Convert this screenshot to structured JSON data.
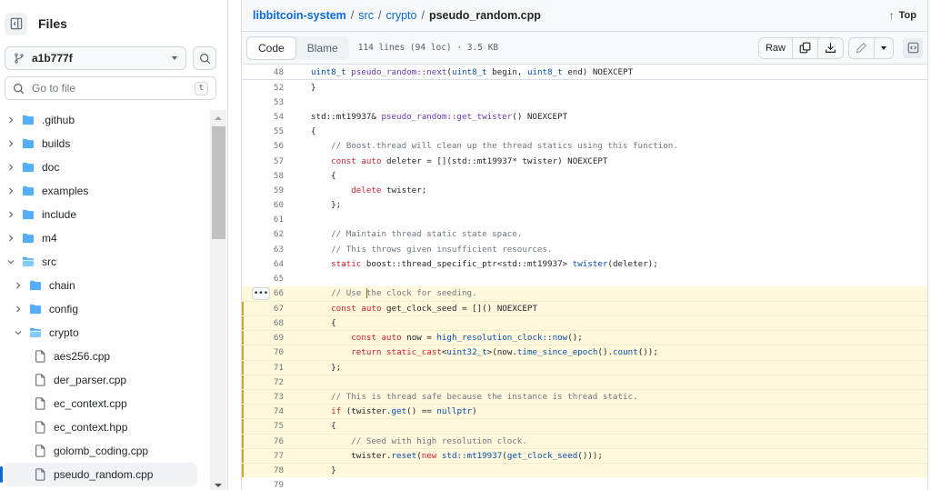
{
  "sidebar": {
    "title": "Files",
    "toggle_icon": "sidebar-collapse-icon",
    "branch": "a1b777f",
    "goto_placeholder": "Go to file",
    "goto_shortcut": "t",
    "tree": [
      {
        "label": ".github",
        "type": "folder",
        "depth": 0,
        "expanded": false
      },
      {
        "label": "builds",
        "type": "folder",
        "depth": 0,
        "expanded": false
      },
      {
        "label": "doc",
        "type": "folder",
        "depth": 0,
        "expanded": false
      },
      {
        "label": "examples",
        "type": "folder",
        "depth": 0,
        "expanded": false
      },
      {
        "label": "include",
        "type": "folder",
        "depth": 0,
        "expanded": false
      },
      {
        "label": "m4",
        "type": "folder",
        "depth": 0,
        "expanded": false
      },
      {
        "label": "src",
        "type": "folder",
        "depth": 0,
        "expanded": true
      },
      {
        "label": "chain",
        "type": "folder",
        "depth": 1,
        "expanded": false
      },
      {
        "label": "config",
        "type": "folder",
        "depth": 1,
        "expanded": false
      },
      {
        "label": "crypto",
        "type": "folder",
        "depth": 1,
        "expanded": true
      },
      {
        "label": "aes256.cpp",
        "type": "file",
        "depth": 2
      },
      {
        "label": "der_parser.cpp",
        "type": "file",
        "depth": 2
      },
      {
        "label": "ec_context.cpp",
        "type": "file",
        "depth": 2
      },
      {
        "label": "ec_context.hpp",
        "type": "file",
        "depth": 2
      },
      {
        "label": "golomb_coding.cpp",
        "type": "file",
        "depth": 2
      },
      {
        "label": "pseudo_random.cpp",
        "type": "file",
        "depth": 2,
        "selected": true
      }
    ]
  },
  "header": {
    "breadcrumb": {
      "repo": "libbitcoin-system",
      "parts": [
        "src",
        "crypto"
      ],
      "file": "pseudo_random.cpp",
      "separator": "/"
    },
    "top_label": "Top"
  },
  "toolbar": {
    "code_tab": "Code",
    "blame_tab": "Blame",
    "file_info": "114 lines (94 loc) · 3.5 KB",
    "raw_label": "Raw"
  },
  "code": {
    "sticky": {
      "n": "48",
      "tokens": [
        [
          "ty",
          "uint8_t"
        ],
        [
          "pl",
          " "
        ],
        [
          "fn",
          "pseudo_random::next"
        ],
        [
          "pl",
          "("
        ],
        [
          "ty",
          "uint8_t"
        ],
        [
          "pl",
          " begin, "
        ],
        [
          "ty",
          "uint8_t"
        ],
        [
          "pl",
          " end) NOEXCEPT"
        ]
      ]
    },
    "lines": [
      {
        "n": "52",
        "tokens": [
          [
            "pl",
            "}"
          ]
        ]
      },
      {
        "n": "53",
        "tokens": []
      },
      {
        "n": "54",
        "tokens": [
          [
            "pl",
            "std::mt19937& "
          ],
          [
            "fn",
            "pseudo_random::get_twister"
          ],
          [
            "pl",
            "() NOEXCEPT"
          ]
        ]
      },
      {
        "n": "55",
        "tokens": [
          [
            "pl",
            "{"
          ]
        ]
      },
      {
        "n": "56",
        "tokens": [
          [
            "pl",
            "    "
          ],
          [
            "cm",
            "// Boost.thread will clean up the thread statics using this function."
          ]
        ]
      },
      {
        "n": "57",
        "tokens": [
          [
            "pl",
            "    "
          ],
          [
            "kw",
            "const"
          ],
          [
            "pl",
            " "
          ],
          [
            "kw",
            "auto"
          ],
          [
            "pl",
            " deleter = [](std::mt19937* twister) NOEXCEPT"
          ]
        ]
      },
      {
        "n": "58",
        "tokens": [
          [
            "pl",
            "    {"
          ]
        ]
      },
      {
        "n": "59",
        "tokens": [
          [
            "pl",
            "        "
          ],
          [
            "kw",
            "delete"
          ],
          [
            "pl",
            " twister;"
          ]
        ]
      },
      {
        "n": "60",
        "tokens": [
          [
            "pl",
            "    };"
          ]
        ]
      },
      {
        "n": "61",
        "tokens": []
      },
      {
        "n": "62",
        "tokens": [
          [
            "pl",
            "    "
          ],
          [
            "cm",
            "// Maintain thread static state space."
          ]
        ]
      },
      {
        "n": "63",
        "tokens": [
          [
            "pl",
            "    "
          ],
          [
            "cm",
            "// This throws given insufficient resources."
          ]
        ]
      },
      {
        "n": "64",
        "tokens": [
          [
            "pl",
            "    "
          ],
          [
            "kw",
            "static"
          ],
          [
            "pl",
            " boost::thread_specific_ptr<std::mt19937> "
          ],
          [
            "ty",
            "twister"
          ],
          [
            "pl",
            "(deleter);"
          ]
        ]
      },
      {
        "n": "65",
        "tokens": []
      },
      {
        "n": "66",
        "hl": true,
        "dots": true,
        "tokens": [
          [
            "pl",
            "    "
          ],
          [
            "cm",
            "// Use "
          ],
          [
            "cursor",
            ""
          ],
          [
            "cm",
            "the clock for seeding."
          ]
        ]
      },
      {
        "n": "67",
        "hl": true,
        "bar": true,
        "tokens": [
          [
            "pl",
            "    "
          ],
          [
            "kw",
            "const"
          ],
          [
            "pl",
            " "
          ],
          [
            "kw",
            "auto"
          ],
          [
            "pl",
            " get_clock_seed = []() NOEXCEPT"
          ]
        ]
      },
      {
        "n": "68",
        "hl": true,
        "bar": true,
        "tokens": [
          [
            "pl",
            "    {"
          ]
        ]
      },
      {
        "n": "69",
        "hl": true,
        "bar": true,
        "tokens": [
          [
            "pl",
            "        "
          ],
          [
            "kw",
            "const"
          ],
          [
            "pl",
            " "
          ],
          [
            "kw",
            "auto"
          ],
          [
            "pl",
            " now = "
          ],
          [
            "ty",
            "high_resolution_clock::now"
          ],
          [
            "pl",
            "();"
          ]
        ]
      },
      {
        "n": "70",
        "hl": true,
        "bar": true,
        "tokens": [
          [
            "pl",
            "        "
          ],
          [
            "kw",
            "return"
          ],
          [
            "pl",
            " "
          ],
          [
            "kw",
            "static_cast"
          ],
          [
            "pl",
            "<"
          ],
          [
            "ty",
            "uint32_t"
          ],
          [
            "pl",
            ">(now."
          ],
          [
            "ty",
            "time_since_epoch"
          ],
          [
            "pl",
            "()."
          ],
          [
            "ty",
            "count"
          ],
          [
            "pl",
            "());"
          ]
        ]
      },
      {
        "n": "71",
        "hl": true,
        "bar": true,
        "tokens": [
          [
            "pl",
            "    };"
          ]
        ]
      },
      {
        "n": "72",
        "hl": true,
        "bar": true,
        "tokens": []
      },
      {
        "n": "73",
        "hl": true,
        "bar": true,
        "tokens": [
          [
            "pl",
            "    "
          ],
          [
            "cm",
            "// This is thread safe because the instance is thread static."
          ]
        ]
      },
      {
        "n": "74",
        "hl": true,
        "bar": true,
        "tokens": [
          [
            "pl",
            "    "
          ],
          [
            "kw",
            "if"
          ],
          [
            "pl",
            " (twister."
          ],
          [
            "ty",
            "get"
          ],
          [
            "pl",
            "() == "
          ],
          [
            "ty",
            "nullptr"
          ],
          [
            "pl",
            ")"
          ]
        ]
      },
      {
        "n": "75",
        "hl": true,
        "bar": true,
        "tokens": [
          [
            "pl",
            "    {"
          ]
        ]
      },
      {
        "n": "76",
        "hl": true,
        "bar": true,
        "tokens": [
          [
            "pl",
            "        "
          ],
          [
            "cm",
            "// Seed with high resolution clock."
          ]
        ]
      },
      {
        "n": "77",
        "hl": true,
        "bar": true,
        "tokens": [
          [
            "pl",
            "        twister."
          ],
          [
            "ty",
            "reset"
          ],
          [
            "pl",
            "("
          ],
          [
            "kw",
            "new"
          ],
          [
            "pl",
            " "
          ],
          [
            "ty",
            "std::mt19937"
          ],
          [
            "pl",
            "("
          ],
          [
            "ty",
            "get_clock_seed"
          ],
          [
            "pl",
            "()));"
          ]
        ]
      },
      {
        "n": "78",
        "hl": true,
        "bar": true,
        "tokens": [
          [
            "pl",
            "    }"
          ]
        ]
      },
      {
        "n": "79",
        "tokens": []
      }
    ]
  }
}
